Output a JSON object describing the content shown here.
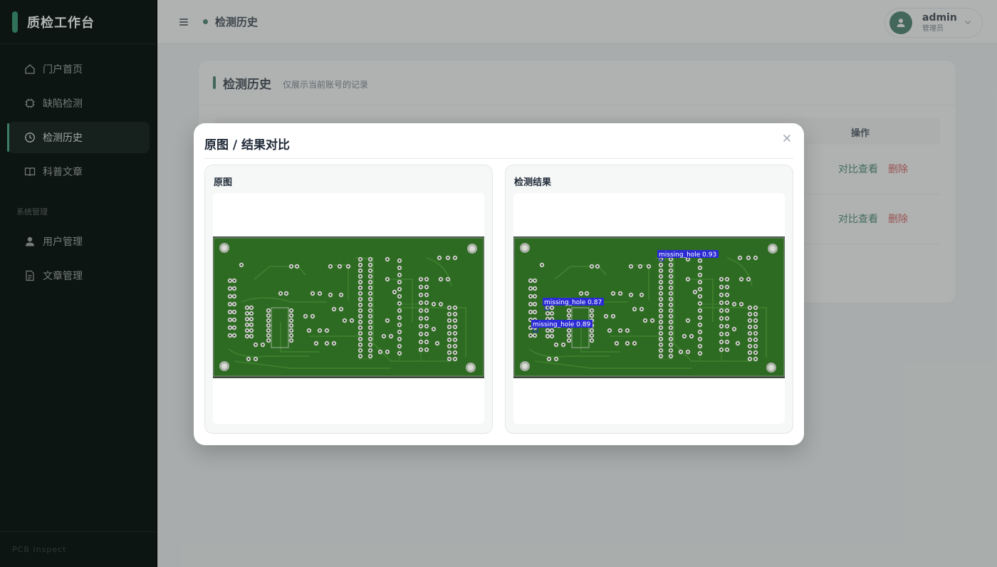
{
  "sidebar": {
    "brand": "质检工作台",
    "items": [
      {
        "label": "门户首页",
        "icon": "home-icon",
        "active": false
      },
      {
        "label": "缺陷检测",
        "icon": "chip-icon",
        "active": false
      },
      {
        "label": "检测历史",
        "icon": "clock-icon",
        "active": true
      },
      {
        "label": "科普文章",
        "icon": "book-icon",
        "active": false
      }
    ],
    "section_label": "系统管理",
    "admin_items": [
      {
        "label": "用户管理",
        "icon": "user-icon"
      },
      {
        "label": "文章管理",
        "icon": "document-icon"
      }
    ],
    "footer": "PCB Inspect"
  },
  "topbar": {
    "breadcrumb": "检测历史",
    "user": {
      "name": "admin",
      "role": "管理员"
    }
  },
  "page": {
    "title": "检测历史",
    "subtitle": "仅展示当前账号的记录",
    "table": {
      "ops_header": "操作",
      "rows": [
        {
          "view": "对比查看",
          "delete": "删除"
        },
        {
          "view": "对比查看",
          "delete": "删除"
        }
      ]
    }
  },
  "modal": {
    "title": "原图 / 结果对比",
    "original_label": "原图",
    "result_label": "检测结果",
    "detections": [
      {
        "label": "missing_hole",
        "score": "0.93"
      },
      {
        "label": "missing_hole",
        "score": "0.87"
      },
      {
        "label": "missing_hole",
        "score": "0.89"
      }
    ]
  },
  "colors": {
    "accent": "#2f6f5a",
    "danger": "#d14b4b",
    "pcb_green": "#2e6b22",
    "detection_box": "#2b2bd6"
  }
}
